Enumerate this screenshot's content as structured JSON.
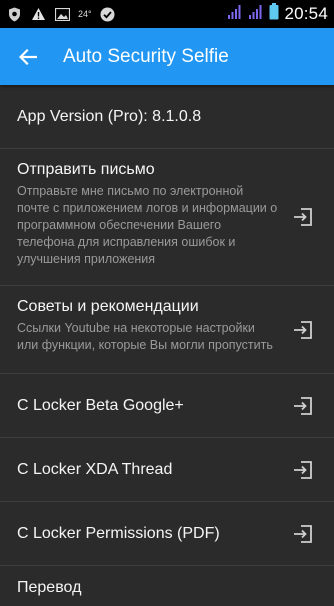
{
  "status": {
    "temperature": "24°",
    "time": "20:54"
  },
  "appbar": {
    "title": "Auto Security Selfie",
    "back_icon": "arrow-back-icon"
  },
  "list": {
    "items": [
      {
        "title": "App Version (Pro): 8.1.0.8",
        "subtitle": "",
        "icon": ""
      },
      {
        "title": "Отправить письмо",
        "subtitle": "Отправьте мне письмо по электронной почте с приложением логов и информации о программном обеспечении Вашего телефона для исправления ошибок и улучшения приложения",
        "icon": "open-in-icon"
      },
      {
        "title": "Советы и рекомендации",
        "subtitle": "Ссылки Youtube на некоторые настройки или функции, которые Вы могли пропустить",
        "icon": "open-in-icon"
      },
      {
        "title": "C Locker Beta Google+",
        "subtitle": "",
        "icon": "open-in-icon"
      },
      {
        "title": "C Locker XDA Thread",
        "subtitle": "",
        "icon": "open-in-icon"
      },
      {
        "title": "C Locker Permissions (PDF)",
        "subtitle": "",
        "icon": "open-in-icon"
      },
      {
        "title": "Перевод",
        "subtitle": "",
        "icon": ""
      }
    ]
  },
  "colors": {
    "appbar": "#2196f3",
    "background": "#2b2b2b",
    "divider": "#3d3d3d",
    "wifi_signal": "#7b68ee",
    "battery": "#5ec8f0"
  }
}
